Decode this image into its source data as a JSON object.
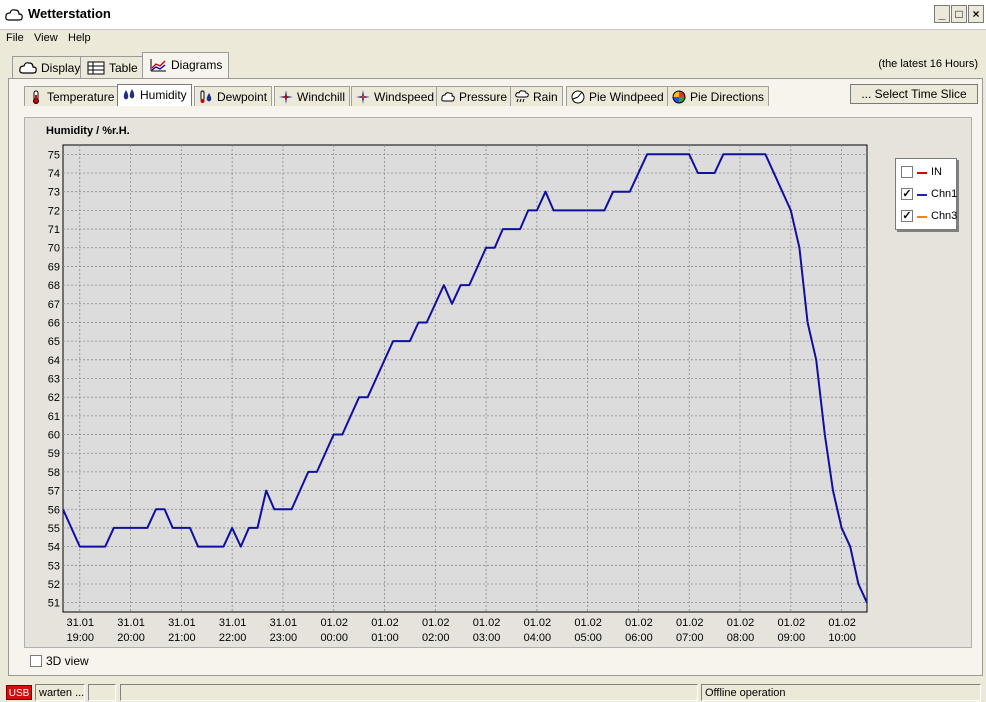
{
  "window": {
    "title": "Wetterstation",
    "buttons": [
      "_",
      "□",
      "×"
    ]
  },
  "menu": {
    "items": [
      "File",
      "View",
      "Help"
    ]
  },
  "main_tabs": [
    {
      "label": "Display",
      "icon": "cloud-icon"
    },
    {
      "label": "Table",
      "icon": "table-icon"
    },
    {
      "label": "Diagrams",
      "icon": "diagram-icon",
      "active": true
    }
  ],
  "range_label": "(the latest 16 Hours)",
  "sub_tabs": [
    {
      "label": "Temperature",
      "icon": "thermometer-icon"
    },
    {
      "label": "Humidity",
      "icon": "humidity-icon",
      "active": true
    },
    {
      "label": "Dewpoint",
      "icon": "dewpoint-icon"
    },
    {
      "label": "Windchill",
      "icon": "windchill-icon"
    },
    {
      "label": "Windspeed",
      "icon": "windspeed-icon"
    },
    {
      "label": "Pressure",
      "icon": "pressure-icon"
    },
    {
      "label": "Rain",
      "icon": "rain-icon"
    },
    {
      "label": "Pie Windpeed",
      "icon": "pie-windspeed-icon"
    },
    {
      "label": "Pie Directions",
      "icon": "pie-directions-icon"
    }
  ],
  "select_time_slice": "... Select Time Slice",
  "three_d_view": {
    "label": "3D view",
    "checked": false
  },
  "status": {
    "usb": "USB",
    "state": "warten ...",
    "mode": "Offline operation"
  },
  "colors": {
    "series_chn1": "#1010a0",
    "legend_in": "#e00000",
    "legend_chn1": "#2020c0",
    "legend_chn3": "#f08020"
  },
  "chart_data": {
    "type": "line",
    "title": "Humidity / %r.H.",
    "ylim": [
      50.5,
      75.5
    ],
    "y_ticks": [
      51,
      52,
      53,
      54,
      55,
      56,
      57,
      58,
      59,
      60,
      61,
      62,
      63,
      64,
      65,
      66,
      67,
      68,
      69,
      70,
      71,
      72,
      73,
      74,
      75
    ],
    "x_ticks": [
      {
        "date": "31.01",
        "time": "19:00",
        "h": 0
      },
      {
        "date": "31.01",
        "time": "20:00",
        "h": 1
      },
      {
        "date": "31.01",
        "time": "21:00",
        "h": 2
      },
      {
        "date": "31.01",
        "time": "22:00",
        "h": 3
      },
      {
        "date": "31.01",
        "time": "23:00",
        "h": 4
      },
      {
        "date": "01.02",
        "time": "00:00",
        "h": 5
      },
      {
        "date": "01.02",
        "time": "01:00",
        "h": 6
      },
      {
        "date": "01.02",
        "time": "02:00",
        "h": 7
      },
      {
        "date": "01.02",
        "time": "03:00",
        "h": 8
      },
      {
        "date": "01.02",
        "time": "04:00",
        "h": 9
      },
      {
        "date": "01.02",
        "time": "05:00",
        "h": 10
      },
      {
        "date": "01.02",
        "time": "06:00",
        "h": 11
      },
      {
        "date": "01.02",
        "time": "07:00",
        "h": 12
      },
      {
        "date": "01.02",
        "time": "08:00",
        "h": 13
      },
      {
        "date": "01.02",
        "time": "09:00",
        "h": 14
      },
      {
        "date": "01.02",
        "time": "10:00",
        "h": 15
      }
    ],
    "xlim": [
      -0.33,
      15.5
    ],
    "grid": true,
    "legend": [
      {
        "name": "IN",
        "checked": false
      },
      {
        "name": "Chn1",
        "checked": true
      },
      {
        "name": "Chn3",
        "checked": true
      }
    ],
    "series": [
      {
        "name": "Chn1",
        "points": [
          [
            -0.33,
            56
          ],
          [
            0.0,
            54
          ],
          [
            0.5,
            54
          ],
          [
            0.67,
            55
          ],
          [
            1.33,
            55
          ],
          [
            1.5,
            56
          ],
          [
            1.67,
            56
          ],
          [
            1.83,
            55
          ],
          [
            2.17,
            55
          ],
          [
            2.33,
            54
          ],
          [
            2.83,
            54
          ],
          [
            3.0,
            55
          ],
          [
            3.17,
            54
          ],
          [
            3.33,
            55
          ],
          [
            3.5,
            55
          ],
          [
            3.67,
            57
          ],
          [
            3.83,
            56
          ],
          [
            4.17,
            56
          ],
          [
            4.5,
            58
          ],
          [
            4.67,
            58
          ],
          [
            5.0,
            60
          ],
          [
            5.17,
            60
          ],
          [
            5.5,
            62
          ],
          [
            5.67,
            62
          ],
          [
            6.17,
            65
          ],
          [
            6.5,
            65
          ],
          [
            6.67,
            66
          ],
          [
            6.83,
            66
          ],
          [
            7.17,
            68
          ],
          [
            7.33,
            67
          ],
          [
            7.5,
            68
          ],
          [
            7.67,
            68
          ],
          [
            8.0,
            70
          ],
          [
            8.17,
            70
          ],
          [
            8.33,
            71
          ],
          [
            8.67,
            71
          ],
          [
            8.83,
            72
          ],
          [
            9.0,
            72
          ],
          [
            9.17,
            73
          ],
          [
            9.33,
            72
          ],
          [
            10.33,
            72
          ],
          [
            10.5,
            73
          ],
          [
            10.83,
            73
          ],
          [
            11.17,
            75
          ],
          [
            12.0,
            75
          ],
          [
            12.17,
            74
          ],
          [
            12.5,
            74
          ],
          [
            12.67,
            75
          ],
          [
            13.5,
            75
          ],
          [
            14.0,
            72
          ],
          [
            14.17,
            70
          ],
          [
            14.33,
            66
          ],
          [
            14.5,
            64
          ],
          [
            14.67,
            60
          ],
          [
            14.83,
            57
          ],
          [
            15.0,
            55
          ],
          [
            15.17,
            54
          ],
          [
            15.33,
            52
          ],
          [
            15.5,
            51
          ]
        ]
      }
    ]
  }
}
